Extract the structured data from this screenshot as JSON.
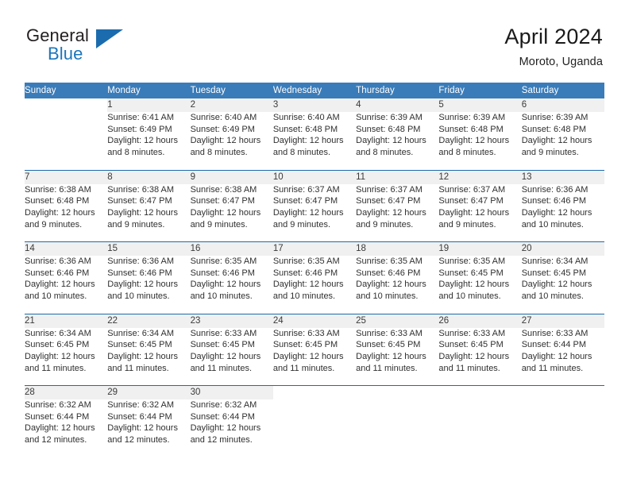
{
  "branding": {
    "name_part1": "General",
    "name_part2": "Blue",
    "triangle_icon": "triangle-logo-icon"
  },
  "header": {
    "title": "April 2024",
    "location": "Moroto, Uganda"
  },
  "calendar": {
    "weekday_headers": [
      "Sunday",
      "Monday",
      "Tuesday",
      "Wednesday",
      "Thursday",
      "Friday",
      "Saturday"
    ],
    "colors": {
      "header_blue": "#3a7cb9",
      "separator_blue": "#1b6cae",
      "daynum_strip": "#f0f0f0",
      "logo_blue": "#1b76bc",
      "text": "#303030"
    },
    "weeks": [
      {
        "days": [
          {
            "num": "",
            "empty": true,
            "sunrise": "",
            "sunset": "",
            "daylight1": "",
            "daylight2": ""
          },
          {
            "num": "1",
            "empty": false,
            "sunrise": "Sunrise: 6:41 AM",
            "sunset": "Sunset: 6:49 PM",
            "daylight1": "Daylight: 12 hours",
            "daylight2": "and 8 minutes."
          },
          {
            "num": "2",
            "empty": false,
            "sunrise": "Sunrise: 6:40 AM",
            "sunset": "Sunset: 6:49 PM",
            "daylight1": "Daylight: 12 hours",
            "daylight2": "and 8 minutes."
          },
          {
            "num": "3",
            "empty": false,
            "sunrise": "Sunrise: 6:40 AM",
            "sunset": "Sunset: 6:48 PM",
            "daylight1": "Daylight: 12 hours",
            "daylight2": "and 8 minutes."
          },
          {
            "num": "4",
            "empty": false,
            "sunrise": "Sunrise: 6:39 AM",
            "sunset": "Sunset: 6:48 PM",
            "daylight1": "Daylight: 12 hours",
            "daylight2": "and 8 minutes."
          },
          {
            "num": "5",
            "empty": false,
            "sunrise": "Sunrise: 6:39 AM",
            "sunset": "Sunset: 6:48 PM",
            "daylight1": "Daylight: 12 hours",
            "daylight2": "and 8 minutes."
          },
          {
            "num": "6",
            "empty": false,
            "sunrise": "Sunrise: 6:39 AM",
            "sunset": "Sunset: 6:48 PM",
            "daylight1": "Daylight: 12 hours",
            "daylight2": "and 9 minutes."
          }
        ]
      },
      {
        "days": [
          {
            "num": "7",
            "empty": false,
            "sunrise": "Sunrise: 6:38 AM",
            "sunset": "Sunset: 6:48 PM",
            "daylight1": "Daylight: 12 hours",
            "daylight2": "and 9 minutes."
          },
          {
            "num": "8",
            "empty": false,
            "sunrise": "Sunrise: 6:38 AM",
            "sunset": "Sunset: 6:47 PM",
            "daylight1": "Daylight: 12 hours",
            "daylight2": "and 9 minutes."
          },
          {
            "num": "9",
            "empty": false,
            "sunrise": "Sunrise: 6:38 AM",
            "sunset": "Sunset: 6:47 PM",
            "daylight1": "Daylight: 12 hours",
            "daylight2": "and 9 minutes."
          },
          {
            "num": "10",
            "empty": false,
            "sunrise": "Sunrise: 6:37 AM",
            "sunset": "Sunset: 6:47 PM",
            "daylight1": "Daylight: 12 hours",
            "daylight2": "and 9 minutes."
          },
          {
            "num": "11",
            "empty": false,
            "sunrise": "Sunrise: 6:37 AM",
            "sunset": "Sunset: 6:47 PM",
            "daylight1": "Daylight: 12 hours",
            "daylight2": "and 9 minutes."
          },
          {
            "num": "12",
            "empty": false,
            "sunrise": "Sunrise: 6:37 AM",
            "sunset": "Sunset: 6:47 PM",
            "daylight1": "Daylight: 12 hours",
            "daylight2": "and 9 minutes."
          },
          {
            "num": "13",
            "empty": false,
            "sunrise": "Sunrise: 6:36 AM",
            "sunset": "Sunset: 6:46 PM",
            "daylight1": "Daylight: 12 hours",
            "daylight2": "and 10 minutes."
          }
        ]
      },
      {
        "days": [
          {
            "num": "14",
            "empty": false,
            "sunrise": "Sunrise: 6:36 AM",
            "sunset": "Sunset: 6:46 PM",
            "daylight1": "Daylight: 12 hours",
            "daylight2": "and 10 minutes."
          },
          {
            "num": "15",
            "empty": false,
            "sunrise": "Sunrise: 6:36 AM",
            "sunset": "Sunset: 6:46 PM",
            "daylight1": "Daylight: 12 hours",
            "daylight2": "and 10 minutes."
          },
          {
            "num": "16",
            "empty": false,
            "sunrise": "Sunrise: 6:35 AM",
            "sunset": "Sunset: 6:46 PM",
            "daylight1": "Daylight: 12 hours",
            "daylight2": "and 10 minutes."
          },
          {
            "num": "17",
            "empty": false,
            "sunrise": "Sunrise: 6:35 AM",
            "sunset": "Sunset: 6:46 PM",
            "daylight1": "Daylight: 12 hours",
            "daylight2": "and 10 minutes."
          },
          {
            "num": "18",
            "empty": false,
            "sunrise": "Sunrise: 6:35 AM",
            "sunset": "Sunset: 6:46 PM",
            "daylight1": "Daylight: 12 hours",
            "daylight2": "and 10 minutes."
          },
          {
            "num": "19",
            "empty": false,
            "sunrise": "Sunrise: 6:35 AM",
            "sunset": "Sunset: 6:45 PM",
            "daylight1": "Daylight: 12 hours",
            "daylight2": "and 10 minutes."
          },
          {
            "num": "20",
            "empty": false,
            "sunrise": "Sunrise: 6:34 AM",
            "sunset": "Sunset: 6:45 PM",
            "daylight1": "Daylight: 12 hours",
            "daylight2": "and 10 minutes."
          }
        ]
      },
      {
        "days": [
          {
            "num": "21",
            "empty": false,
            "sunrise": "Sunrise: 6:34 AM",
            "sunset": "Sunset: 6:45 PM",
            "daylight1": "Daylight: 12 hours",
            "daylight2": "and 11 minutes."
          },
          {
            "num": "22",
            "empty": false,
            "sunrise": "Sunrise: 6:34 AM",
            "sunset": "Sunset: 6:45 PM",
            "daylight1": "Daylight: 12 hours",
            "daylight2": "and 11 minutes."
          },
          {
            "num": "23",
            "empty": false,
            "sunrise": "Sunrise: 6:33 AM",
            "sunset": "Sunset: 6:45 PM",
            "daylight1": "Daylight: 12 hours",
            "daylight2": "and 11 minutes."
          },
          {
            "num": "24",
            "empty": false,
            "sunrise": "Sunrise: 6:33 AM",
            "sunset": "Sunset: 6:45 PM",
            "daylight1": "Daylight: 12 hours",
            "daylight2": "and 11 minutes."
          },
          {
            "num": "25",
            "empty": false,
            "sunrise": "Sunrise: 6:33 AM",
            "sunset": "Sunset: 6:45 PM",
            "daylight1": "Daylight: 12 hours",
            "daylight2": "and 11 minutes."
          },
          {
            "num": "26",
            "empty": false,
            "sunrise": "Sunrise: 6:33 AM",
            "sunset": "Sunset: 6:45 PM",
            "daylight1": "Daylight: 12 hours",
            "daylight2": "and 11 minutes."
          },
          {
            "num": "27",
            "empty": false,
            "sunrise": "Sunrise: 6:33 AM",
            "sunset": "Sunset: 6:44 PM",
            "daylight1": "Daylight: 12 hours",
            "daylight2": "and 11 minutes."
          }
        ]
      },
      {
        "days": [
          {
            "num": "28",
            "empty": false,
            "sunrise": "Sunrise: 6:32 AM",
            "sunset": "Sunset: 6:44 PM",
            "daylight1": "Daylight: 12 hours",
            "daylight2": "and 12 minutes."
          },
          {
            "num": "29",
            "empty": false,
            "sunrise": "Sunrise: 6:32 AM",
            "sunset": "Sunset: 6:44 PM",
            "daylight1": "Daylight: 12 hours",
            "daylight2": "and 12 minutes."
          },
          {
            "num": "30",
            "empty": false,
            "sunrise": "Sunrise: 6:32 AM",
            "sunset": "Sunset: 6:44 PM",
            "daylight1": "Daylight: 12 hours",
            "daylight2": "and 12 minutes."
          },
          {
            "num": "",
            "empty": true,
            "sunrise": "",
            "sunset": "",
            "daylight1": "",
            "daylight2": ""
          },
          {
            "num": "",
            "empty": true,
            "sunrise": "",
            "sunset": "",
            "daylight1": "",
            "daylight2": ""
          },
          {
            "num": "",
            "empty": true,
            "sunrise": "",
            "sunset": "",
            "daylight1": "",
            "daylight2": ""
          },
          {
            "num": "",
            "empty": true,
            "sunrise": "",
            "sunset": "",
            "daylight1": "",
            "daylight2": ""
          }
        ]
      }
    ]
  }
}
